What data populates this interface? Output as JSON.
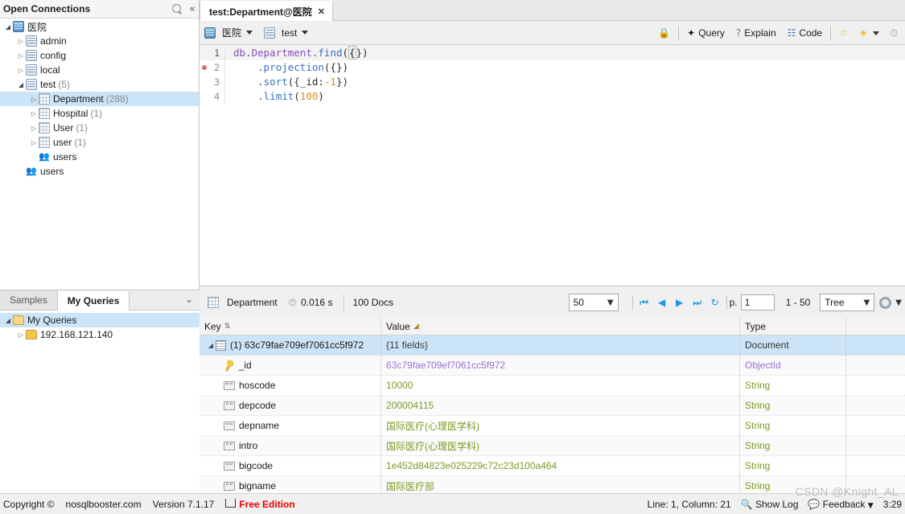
{
  "left_panel": {
    "header": {
      "title": "Open Connections",
      "search_icon": "search-icon",
      "collapse_icon": "collapse-left-icon"
    },
    "tree": [
      {
        "depth": 0,
        "arrow": "open",
        "icon": "server-icon",
        "label": "医院",
        "count": ""
      },
      {
        "depth": 1,
        "arrow": "closed",
        "icon": "database-icon",
        "label": "admin",
        "count": ""
      },
      {
        "depth": 1,
        "arrow": "closed",
        "icon": "database-icon",
        "label": "config",
        "count": ""
      },
      {
        "depth": 1,
        "arrow": "closed",
        "icon": "database-icon",
        "label": "local",
        "count": ""
      },
      {
        "depth": 1,
        "arrow": "open",
        "icon": "database-icon",
        "label": "test",
        "count": "(5)"
      },
      {
        "depth": 2,
        "arrow": "closed",
        "icon": "collection-icon",
        "label": "Department",
        "count": "(288)",
        "selected": true
      },
      {
        "depth": 2,
        "arrow": "closed",
        "icon": "collection-icon",
        "label": "Hospital",
        "count": "(1)"
      },
      {
        "depth": 2,
        "arrow": "closed",
        "icon": "collection-icon",
        "label": "User",
        "count": "(1)"
      },
      {
        "depth": 2,
        "arrow": "closed",
        "icon": "collection-icon",
        "label": "user",
        "count": "(1)"
      },
      {
        "depth": 2,
        "arrow": "none",
        "icon": "users-icon",
        "label": "users",
        "count": ""
      },
      {
        "depth": 1,
        "arrow": "none",
        "icon": "users-icon",
        "label": "users",
        "count": ""
      }
    ]
  },
  "queries_panel": {
    "tabs": [
      {
        "label": "My Queries",
        "active": true
      },
      {
        "label": "Samples",
        "active": false
      }
    ],
    "more_icon": "chevron-double-down-icon",
    "tree": [
      {
        "depth": 0,
        "arrow": "open",
        "icon": "folder-open-icon",
        "label": "My Queries",
        "selected": true
      },
      {
        "depth": 1,
        "arrow": "closed",
        "icon": "folder-icon",
        "label": "192.168.121.140"
      }
    ]
  },
  "editor_tab": {
    "label": "test:Department@医院",
    "close_icon": "close-icon"
  },
  "query_toolbar": {
    "connection": {
      "icon": "server-icon",
      "label": "医院",
      "caret": "chevron-down-icon"
    },
    "database": {
      "icon": "database-icon",
      "label": "test",
      "caret": "chevron-down-icon"
    },
    "buttons": [
      {
        "name": "lock-button",
        "icon": "lock-icon",
        "label": ""
      },
      {
        "name": "query-button",
        "icon": "wand-icon",
        "label": "Query"
      },
      {
        "name": "explain-button",
        "icon": "question-icon",
        "label": "Explain"
      },
      {
        "name": "code-button",
        "icon": "code-icon",
        "label": "Code"
      },
      {
        "name": "add-favorite-button",
        "icon": "star-plus-icon",
        "label": ""
      },
      {
        "name": "favorites-button",
        "icon": "star-icon",
        "label": ""
      },
      {
        "name": "history-button",
        "icon": "clock-icon",
        "label": ""
      }
    ]
  },
  "editor": {
    "lines": [
      {
        "num": "1",
        "breakpoint": false,
        "active": true,
        "tokens": [
          {
            "t": "db",
            "c": "c-kw"
          },
          {
            "t": ".",
            "c": "c-op"
          },
          {
            "t": "Department",
            "c": "c-kw"
          },
          {
            "t": ".",
            "c": "c-op"
          },
          {
            "t": "find",
            "c": "c-fn"
          },
          {
            "t": "(",
            "c": "c-plain"
          },
          {
            "t": "{",
            "c": "cursor-brace"
          },
          {
            "t": "}",
            "c": "c-plain"
          },
          {
            "t": ")",
            "c": "c-plain"
          }
        ]
      },
      {
        "num": "2",
        "breakpoint": true,
        "active": false,
        "tokens": [
          {
            "t": "    .",
            "c": "c-op"
          },
          {
            "t": "projection",
            "c": "c-fn"
          },
          {
            "t": "({})",
            "c": "c-plain"
          }
        ]
      },
      {
        "num": "3",
        "breakpoint": false,
        "active": false,
        "tokens": [
          {
            "t": "    .",
            "c": "c-op"
          },
          {
            "t": "sort",
            "c": "c-fn"
          },
          {
            "t": "({_id:",
            "c": "c-plain"
          },
          {
            "t": "-1",
            "c": "c-num"
          },
          {
            "t": "})",
            "c": "c-plain"
          }
        ]
      },
      {
        "num": "4",
        "breakpoint": false,
        "active": false,
        "tokens": [
          {
            "t": "    .",
            "c": "c-op"
          },
          {
            "t": "limit",
            "c": "c-fn"
          },
          {
            "t": "(",
            "c": "c-plain"
          },
          {
            "t": "100",
            "c": "c-num"
          },
          {
            "t": ")",
            "c": "c-plain"
          }
        ]
      }
    ]
  },
  "result_toolbar": {
    "collection_icon": "collection-icon",
    "collection": "Department",
    "timer_icon": "timer-icon",
    "duration": "0.016 s",
    "doc_count": "100 Docs",
    "page_size": "50",
    "nav": {
      "first_icon": "nav-first-icon",
      "prev_icon": "nav-prev-icon",
      "next_icon": "nav-next-icon",
      "last_icon": "nav-last-icon",
      "refresh_icon": "refresh-icon"
    },
    "page_label": "p.",
    "page_value": "1",
    "range": "1 - 50",
    "view_mode": "Tree",
    "settings_icon": "gear-icon"
  },
  "result_grid": {
    "columns": [
      "Key",
      "Value",
      "Type"
    ],
    "value_filter_icon": "filter-icon",
    "sort_icon": "sort-icon",
    "rows": [
      {
        "indent": 1,
        "icon": "document-icon",
        "arrow": "open",
        "key": "(1) 63c79fae709ef7061cc5f972",
        "value": "{11 fields}",
        "value_num": "11",
        "type": "Document",
        "vclass": "v-plain",
        "tclass": "t-doc",
        "selected": true
      },
      {
        "indent": 2,
        "icon": "key-icon",
        "arrow": "none",
        "key": "_id",
        "value": "63c79fae709ef7061cc5f972",
        "type": "ObjectId",
        "vclass": "v-oid",
        "tclass": "t-oid"
      },
      {
        "indent": 2,
        "icon": "string-icon",
        "arrow": "none",
        "key": "hoscode",
        "value": "10000",
        "type": "String",
        "vclass": "v-str",
        "tclass": "t-str"
      },
      {
        "indent": 2,
        "icon": "string-icon",
        "arrow": "none",
        "key": "depcode",
        "value": "200004115",
        "type": "String",
        "vclass": "v-str",
        "tclass": "t-str"
      },
      {
        "indent": 2,
        "icon": "string-icon",
        "arrow": "none",
        "key": "depname",
        "value": "国际医疗(心理医学科)",
        "type": "String",
        "vclass": "v-str",
        "tclass": "t-str"
      },
      {
        "indent": 2,
        "icon": "string-icon",
        "arrow": "none",
        "key": "intro",
        "value": "国际医疗(心理医学科)",
        "type": "String",
        "vclass": "v-str",
        "tclass": "t-str"
      },
      {
        "indent": 2,
        "icon": "string-icon",
        "arrow": "none",
        "key": "bigcode",
        "value": "1e452d84823e025229c72c23d100a464",
        "type": "String",
        "vclass": "v-str",
        "tclass": "t-str"
      },
      {
        "indent": 2,
        "icon": "string-icon",
        "arrow": "none",
        "key": "bigname",
        "value": "国际医疗部",
        "type": "String",
        "vclass": "v-str",
        "tclass": "t-str"
      }
    ]
  },
  "status_bar": {
    "copyright": "Copyright ©",
    "site": "nosqlbooster.com",
    "version": "Version 7.1.17",
    "edition_icon": "cart-icon",
    "edition": "Free Edition",
    "cursor": "Line: 1, Column: 21",
    "show_log_icon": "log-icon",
    "show_log": "Show Log",
    "feedback_icon": "feedback-icon",
    "feedback": "Feedback",
    "feedback_caret": "chevron-down-icon",
    "clock": "3:29"
  },
  "watermark": "CSDN @Knight_AL"
}
